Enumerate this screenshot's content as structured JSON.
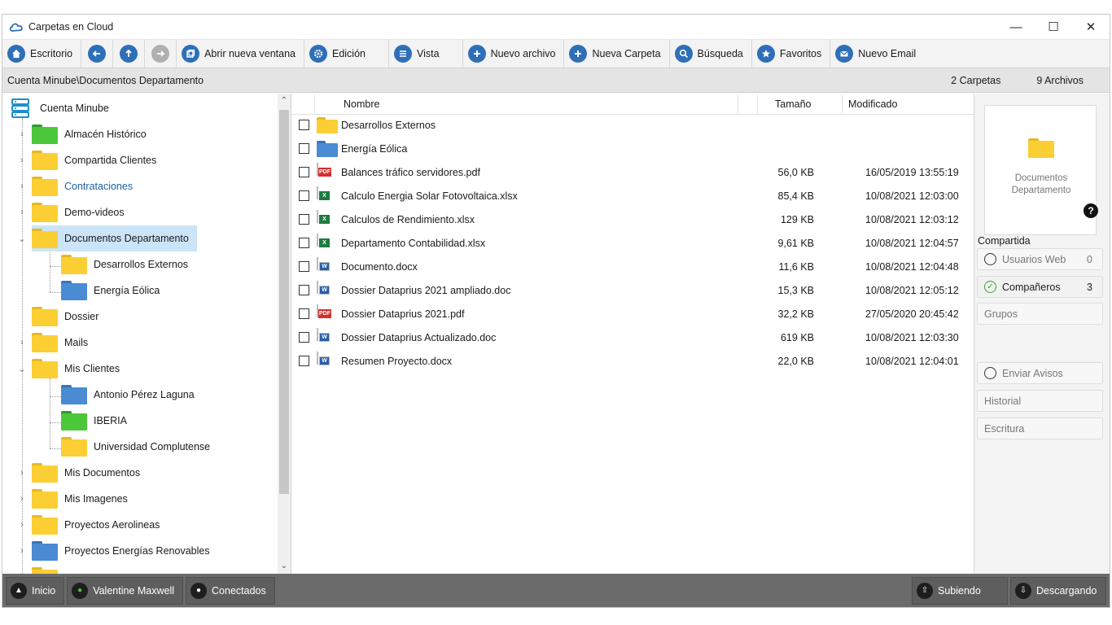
{
  "window": {
    "title": "Carpetas en Cloud"
  },
  "toolbar": {
    "escritorio": "Escritorio",
    "abrir_ventana": "Abrir nueva ventana",
    "edicion": "Edición",
    "vista": "Vista",
    "nuevo_archivo": "Nuevo archivo",
    "nueva_carpeta": "Nueva Carpeta",
    "busqueda": "Búsqueda",
    "favoritos": "Favoritos",
    "nuevo_email": "Nuevo Email"
  },
  "path": {
    "current": "Cuenta Minube\\Documentos Departamento",
    "folders_count": "2 Carpetas",
    "files_count": "9 Archivos"
  },
  "tree": {
    "root": "Cuenta Minube",
    "items": [
      {
        "label": "Almacén Histórico",
        "color": "green"
      },
      {
        "label": "Compartida Clientes",
        "color": "yellow"
      },
      {
        "label": "Contrataciones",
        "color": "yellow"
      },
      {
        "label": "Demo-videos",
        "color": "yellow"
      },
      {
        "label": "Documentos Departamento",
        "color": "yellow"
      },
      {
        "label": "Desarrollos Externos",
        "color": "yellow"
      },
      {
        "label": "Energía Eólica",
        "color": "blue"
      },
      {
        "label": "Dossier",
        "color": "yellow"
      },
      {
        "label": "Mails",
        "color": "yellow"
      },
      {
        "label": "Mis Clientes",
        "color": "yellow"
      },
      {
        "label": "Antonio Pérez Laguna",
        "color": "blue"
      },
      {
        "label": "IBERIA",
        "color": "green"
      },
      {
        "label": "Universidad Complutense",
        "color": "yellow"
      },
      {
        "label": "Mis Documentos",
        "color": "yellow"
      },
      {
        "label": "Mis Imagenes",
        "color": "yellow"
      },
      {
        "label": "Proyectos Aerolineas",
        "color": "yellow"
      },
      {
        "label": "Proyectos Energías Renovables",
        "color": "blue"
      }
    ]
  },
  "files": {
    "headers": {
      "name": "Nombre",
      "size": "Tamaño",
      "modified": "Modificado"
    },
    "rows": [
      {
        "name": "Desarrollos Externos",
        "size": "",
        "modified": "",
        "type": "folder-yellow"
      },
      {
        "name": "Energía Eólica",
        "size": "",
        "modified": "",
        "type": "folder-blue"
      },
      {
        "name": "Balances tráfico servidores.pdf",
        "size": "56,0 KB",
        "modified": "16/05/2019 13:55:19",
        "type": "pdf"
      },
      {
        "name": "Calculo Energia Solar Fotovoltaica.xlsx",
        "size": "85,4 KB",
        "modified": "10/08/2021 12:03:00",
        "type": "xls"
      },
      {
        "name": "Calculos de Rendimiento.xlsx",
        "size": "129 KB",
        "modified": "10/08/2021 12:03:12",
        "type": "xls"
      },
      {
        "name": "Departamento Contabilidad.xlsx",
        "size": "9,61 KB",
        "modified": "10/08/2021 12:04:57",
        "type": "xls"
      },
      {
        "name": "Documento.docx",
        "size": "11,6 KB",
        "modified": "10/08/2021 12:04:48",
        "type": "doc"
      },
      {
        "name": "Dossier Dataprius 2021 ampliado.doc",
        "size": "15,3 KB",
        "modified": "10/08/2021 12:05:12",
        "type": "doc"
      },
      {
        "name": "Dossier Dataprius 2021.pdf",
        "size": "32,2 KB",
        "modified": "27/05/2020 20:45:42",
        "type": "pdf"
      },
      {
        "name": "Dossier Dataprius Actualizado.doc",
        "size": "619 KB",
        "modified": "10/08/2021 12:03:30",
        "type": "doc"
      },
      {
        "name": "Resumen Proyecto.docx",
        "size": "22,0 KB",
        "modified": "10/08/2021 12:04:01",
        "type": "doc"
      }
    ]
  },
  "side": {
    "preview_line1": "Documentos",
    "preview_line2": "Departamento",
    "help": "?",
    "heading": "Compartida",
    "usuarios_web": "Usuarios Web",
    "usuarios_web_count": "0",
    "companeros": "Compañeros",
    "companeros_count": "3",
    "grupos": "Grupos",
    "enviar_avisos": "Enviar Avisos",
    "historial": "Historial",
    "escritura": "Escritura"
  },
  "status": {
    "inicio": "Inicio",
    "user": "Valentine Maxwell",
    "conectados": "Conectados",
    "subiendo": "Subiendo",
    "descargando": "Descargando"
  },
  "colors": {
    "accent": "#2e6fb8",
    "selection": "#cce4f7",
    "statusbar": "#6b6b6b"
  }
}
